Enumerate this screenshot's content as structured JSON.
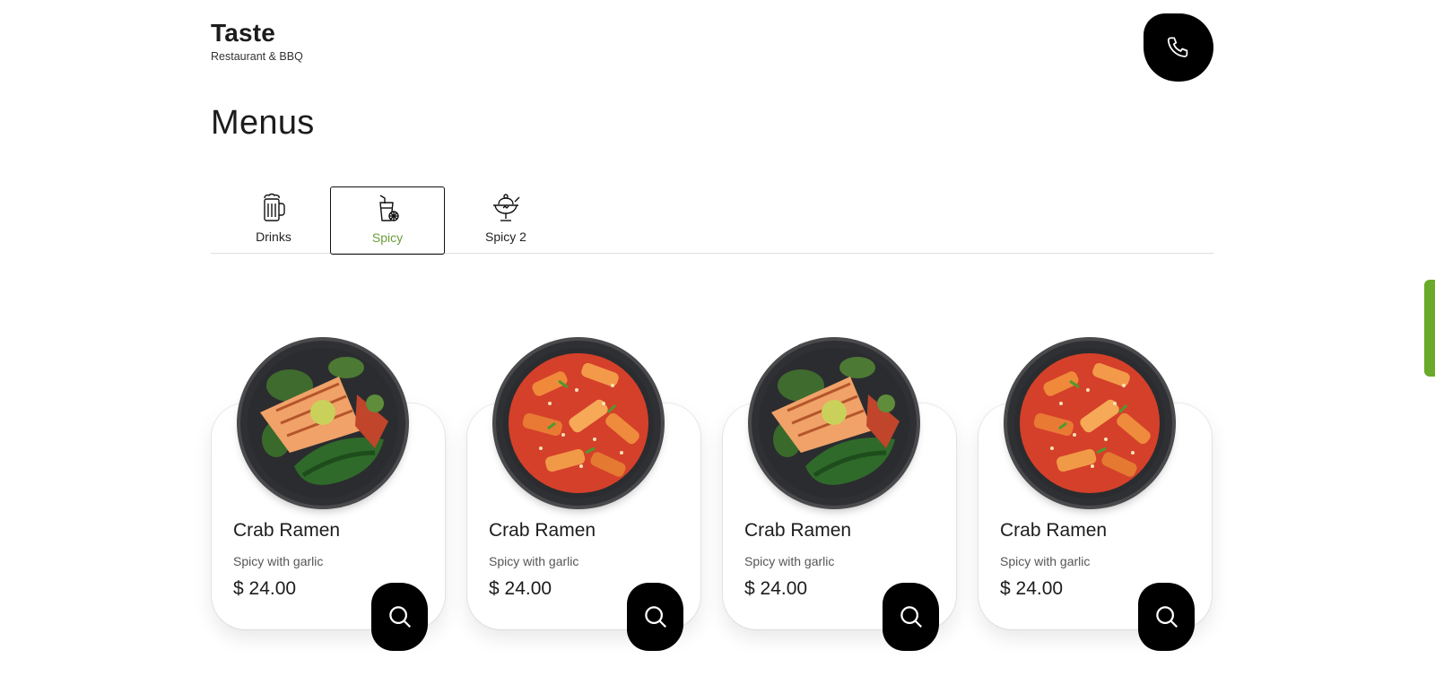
{
  "brand": {
    "name": "Taste",
    "tagline": "Restaurant & BBQ"
  },
  "header": {
    "call_icon": "phone-icon"
  },
  "page": {
    "title": "Menus"
  },
  "tabs": [
    {
      "label": "Drinks",
      "icon": "beer-mug-icon",
      "active": false
    },
    {
      "label": "Spicy",
      "icon": "lemonade-glass-icon",
      "active": true
    },
    {
      "label": "Spicy 2",
      "icon": "sundae-icon",
      "active": false
    }
  ],
  "items": [
    {
      "title": "Crab Ramen",
      "description": "Spicy with garlic",
      "price": "$ 24.00",
      "image": "salmon-bowl"
    },
    {
      "title": "Crab Ramen",
      "description": "Spicy with garlic",
      "price": "$ 24.00",
      "image": "tteokbokki-bowl"
    },
    {
      "title": "Crab Ramen",
      "description": "Spicy with garlic",
      "price": "$ 24.00",
      "image": "salmon-bowl"
    },
    {
      "title": "Crab Ramen",
      "description": "Spicy with garlic",
      "price": "$ 24.00",
      "image": "tteokbokki-bowl"
    }
  ],
  "colors": {
    "accent": "#6a9c3a",
    "scrollbar": "#6aaa2a",
    "button": "#000000"
  }
}
